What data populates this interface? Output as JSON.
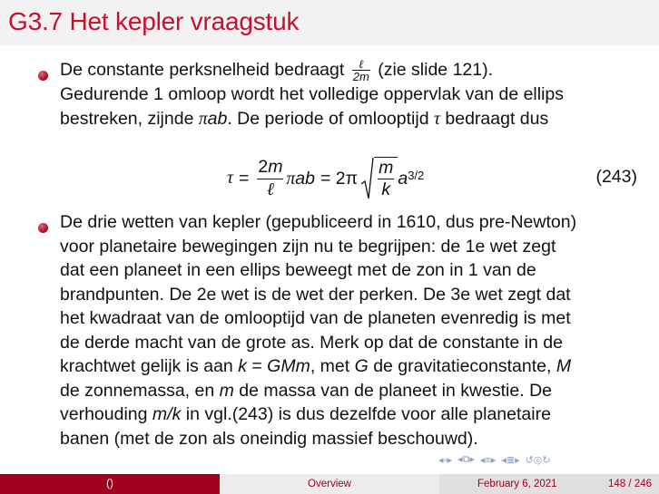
{
  "title": "G3.7 Het kepler vraagstuk",
  "bullet1": {
    "l1_a": "De constante perksnelheid bedraagt",
    "frac_num": "ℓ",
    "frac_den": "2m",
    "l1_b": "(zie slide 121).",
    "l2": "Gedurende 1 omloop wordt het volledige oppervlak van de ellips",
    "l3_a": "bestreken, zijnde",
    "l3_pi": "π",
    "l3_ab": "ab",
    "l3_b": ". De periode of omlooptijd",
    "l3_tau": "τ",
    "l3_c": "bedraagt dus"
  },
  "equation": {
    "lhs": "τ",
    "eq1": "=",
    "f1_num": "2m",
    "f1_den": "ℓ",
    "mid": "πab",
    "eq2": "= 2π",
    "f2_num": "m",
    "f2_den": "k",
    "a": "a",
    "exp": "3/2",
    "number": "(243)"
  },
  "bullet2": {
    "l1": "De drie wetten van kepler (gepubliceerd in 1610, dus pre-Newton)",
    "l2": "voor planetaire bewegingen zijn nu te begrijpen: de 1e wet zegt",
    "l3": "dat een planeet in een ellips beweegt met de zon in 1 van de",
    "l4": "brandpunten. De 2e wet is de wet der perken. De 3e wet zegt dat",
    "l5": "het kwadraat van de omlooptijd van de planeten evenredig is met",
    "l6": "de derde macht van de grote as. Merk op dat de constante in de",
    "l7_a": "krachtwet gelijk is aan",
    "l7_k": "k",
    "l7_eq": "=",
    "l7_gmm": "GMm",
    "l7_b": ", met",
    "l7_g": "G",
    "l7_c": "de gravitatieconstante,",
    "l7_m": "M",
    "l8_a": "de zonnemassa, en",
    "l8_m": "m",
    "l8_b": "de massa van de planeet in kwestie. De",
    "l9_a": "verhouding",
    "l9_mk": "m/k",
    "l9_b": "in vgl.(243) is dus dezelfde voor alle planetaire",
    "l10": "banen (met de zon als oneindig massief beschouwd)."
  },
  "footer": {
    "left": "()",
    "center": "Overview",
    "date": "February 6, 2021",
    "page": "148 / 246"
  },
  "colors": {
    "title": "#c8102e",
    "footer_left_bg": "#a0001c",
    "footer_mid_bg": "#ececec",
    "footer_right_bg": "#e0e0e0",
    "nav": "#8da0c8"
  }
}
